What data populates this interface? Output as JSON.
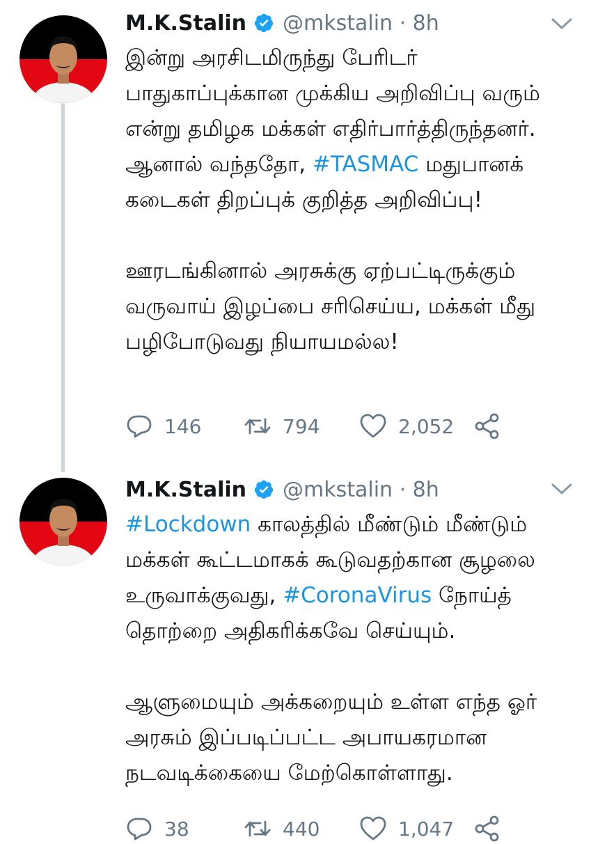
{
  "tweets": [
    {
      "author_name": "M.K.Stalin",
      "handle_time": "@mkstalin · 8h",
      "paragraphs": [
        [
          {
            "text": "இன்று அரசிடமிருந்து பேரிடர் பாதுகாப்புக்கான முக்கிய அறிவிப்பு வரும் என்று தமிழக மக்கள் எதிர்பார்த்திருந்தனர். ஆனால் வந்ததோ, "
          },
          {
            "text": "#TASMAC",
            "hashtag": true
          },
          {
            "text": " மதுபானக் கடைகள் திறப்புக் குறித்த அறிவிப்பு!"
          }
        ],
        [
          {
            "text": "ஊரடங்கினால் அரசுக்கு ஏற்பட்டிருக்கும் வருவாய் இழப்பை சரிசெய்ய, மக்கள் மீது பழிபோடுவது நியாயமல்ல!"
          }
        ]
      ],
      "replies": "146",
      "retweets": "794",
      "likes": "2,052"
    },
    {
      "author_name": "M.K.Stalin",
      "handle_time": "@mkstalin · 8h",
      "paragraphs": [
        [
          {
            "text": "#Lockdown",
            "hashtag": true
          },
          {
            "text": " காலத்தில் மீண்டும் மீண்டும் மக்கள் கூட்டமாகக் கூடுவதற்கான சூழலை உருவாக்குவது, "
          },
          {
            "text": "#CoronaVirus",
            "hashtag": true
          },
          {
            "text": " நோய்த் தொற்றை அதிகரிக்கவே செய்யும்."
          }
        ],
        [
          {
            "text": "ஆளுமையும் அக்கறையும் உள்ள எந்த ஓர் அரசும் இப்படிப்பட்ட அபாயகரமான நடவடிக்கையை மேற்கொள்ளாது."
          }
        ]
      ],
      "replies": "38",
      "retweets": "440",
      "likes": "1,047"
    }
  ],
  "icons": {
    "verified": "verified-badge-icon",
    "menu": "chevron-down-icon",
    "reply": "reply-icon",
    "retweet": "retweet-icon",
    "like": "heart-icon",
    "share": "share-icon"
  },
  "colors": {
    "text": "#14171a",
    "secondary": "#657786",
    "link": "#1b95e0",
    "verified": "#1da1f2",
    "thread_line": "#cdd5db",
    "avatar_black": "#000000",
    "avatar_red": "#e30613"
  }
}
